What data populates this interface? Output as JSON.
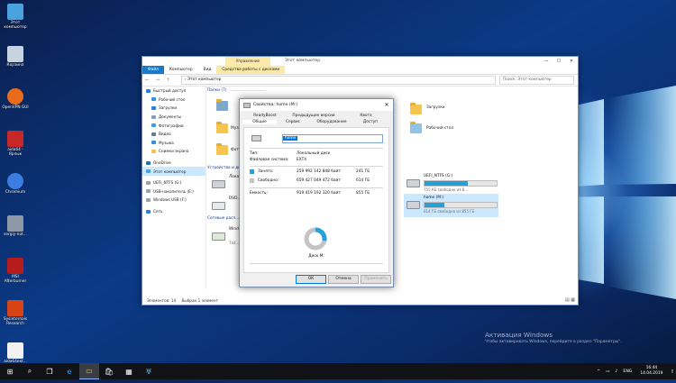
{
  "desktop": {
    "icons": [
      {
        "label": "Этот компьютер",
        "icon": "computer-icon",
        "color": "#4aa3df"
      },
      {
        "label": "Корзина",
        "icon": "recycle-bin-icon",
        "color": "#c7d3df"
      },
      {
        "label": "OpenVPN GUI",
        "icon": "openvpn-icon",
        "color": "#e86b1c"
      },
      {
        "label": "aida64 - Ярлык",
        "icon": "aida64-icon",
        "color": "#c62828"
      },
      {
        "label": "Chromium",
        "icon": "chromium-icon",
        "color": "#3b7de0"
      },
      {
        "label": "sergiy-not...",
        "icon": "user-icon",
        "color": "#8c98a6"
      },
      {
        "label": "MSI Afterburner",
        "icon": "afterburner-icon",
        "color": "#b71c1c"
      },
      {
        "label": "Sysinternals Research",
        "icon": "sysinternals-icon",
        "color": "#d84315"
      },
      {
        "label": "aida64ext...",
        "icon": "text-file-icon",
        "color": "#f2f2f2"
      }
    ]
  },
  "explorer": {
    "context_tab": "Управление",
    "title": "Этот компьютер",
    "controls": {
      "minimize": "—",
      "maximize": "☐",
      "close": "✕"
    },
    "ribbon_tabs": [
      "Файл",
      "Компьютер",
      "Вид",
      "Средства работы с дисками"
    ],
    "address": {
      "nav": "← → ↑",
      "path": "› Этот компьютер",
      "search_placeholder": "Поиск: Этот компьютер"
    },
    "sidebar": [
      {
        "label": "Быстрый доступ",
        "icon": "star-icon",
        "color": "#2c7fd8",
        "indent": false
      },
      {
        "label": "Рабочий стол",
        "icon": "desktop-icon",
        "color": "#3a8fd8",
        "indent": true
      },
      {
        "label": "Загрузки",
        "icon": "download-icon",
        "color": "#2c7fd8",
        "indent": true
      },
      {
        "label": "Документы",
        "icon": "documents-icon",
        "color": "#8a9db3",
        "indent": true
      },
      {
        "label": "Фотографии",
        "icon": "pictures-icon",
        "color": "#4a9ad8",
        "indent": true
      },
      {
        "label": "Видео",
        "icon": "video-icon",
        "color": "#6b7b8c",
        "indent": true
      },
      {
        "label": "Музыка",
        "icon": "music-icon",
        "color": "#3a8fd8",
        "indent": true
      },
      {
        "label": "Снимки экрана",
        "icon": "folder-icon",
        "color": "#f2c44d",
        "indent": true
      },
      {
        "label": "OneDrive",
        "icon": "onedrive-icon",
        "color": "#1f6fc6",
        "indent": false
      },
      {
        "label": "Этот компьютер",
        "icon": "computer-icon",
        "color": "#4aa3df",
        "indent": false,
        "selected": true
      },
      {
        "label": "UEFI_NTFS (G:)",
        "icon": "drive-icon",
        "color": "#9aa3ad",
        "indent": false
      },
      {
        "label": "USB-накопитель (E:)",
        "icon": "usb-drive-icon",
        "color": "#9aa3ad",
        "indent": false
      },
      {
        "label": "Windows USB (F:)",
        "icon": "usb-drive-icon",
        "color": "#9aa3ad",
        "indent": false
      },
      {
        "label": "Сеть",
        "icon": "network-icon",
        "color": "#2c7fd8",
        "indent": false
      }
    ],
    "groups": {
      "folders": "Папки (7)",
      "devices": "Устройства и диски",
      "network": "Сетевые расп..."
    },
    "folders": [
      {
        "label": "Музы..."
      },
      {
        "label": "Фото..."
      },
      {
        "label": "Загрузки"
      },
      {
        "label": "Рабочий стол"
      }
    ],
    "drives": [
      {
        "name": "Лока...",
        "free": "",
        "used_fraction": 0.35
      },
      {
        "name": "DVD...",
        "free": "",
        "used_fraction": 0
      },
      {
        "name": "UEFI_NTFS (G:)",
        "free": "755 КБ свободно из 8...",
        "used_fraction": 0.6
      },
      {
        "name": "home (M:)",
        "free": "614 ГБ свободно из 855 ГБ",
        "used_fraction": 0.28
      },
      {
        "name": "Windo...",
        "free": "744...",
        "used_fraction": 0.3
      }
    ],
    "status": {
      "count": "Элементов: 14",
      "selected": "Выбран 1 элемент"
    }
  },
  "dialog": {
    "title": "Свойства: home (M:)",
    "close": "✕",
    "tabs_row1": [
      "ReadyBoost",
      "Предыдущие версии",
      "Квота"
    ],
    "tabs_row2": [
      "Общие",
      "Сервис",
      "Оборудование",
      "Доступ"
    ],
    "name_value": "home",
    "type_label": "Тип:",
    "type_value": "Локальный диск",
    "fs_label": "Файловая система:",
    "fs_value": "EXT4",
    "used_label": "Занято:",
    "used_bytes": "259 992 142 848 байт",
    "used_size": "241 ГБ",
    "free_label": "Свободно:",
    "free_bytes": "659 427 049 472 байт",
    "free_size": "614 ГБ",
    "cap_label": "Емкость:",
    "cap_bytes": "919 419 192 320 байт",
    "cap_size": "855 ГБ",
    "disk_label": "Диск M:",
    "used_color": "#26a0da",
    "free_color": "#c4c4c4",
    "used_fraction": 0.283,
    "buttons": {
      "ok": "ОК",
      "cancel": "Отмена",
      "apply": "Применить"
    }
  },
  "watermark": {
    "line1": "Активация Windows",
    "line2": "Чтобы активировать Windows, перейдите в раздел \"Параметры\"."
  },
  "taskbar": {
    "start": "⊞",
    "search": "⌕",
    "taskview": "❐",
    "edge": "e",
    "explorer": "▭",
    "store": "🛍",
    "app": "▦",
    "afterburner": "♅",
    "tray_chevron": "^",
    "lang": "ENG",
    "time": "16:44",
    "date": "14.04.2019"
  }
}
